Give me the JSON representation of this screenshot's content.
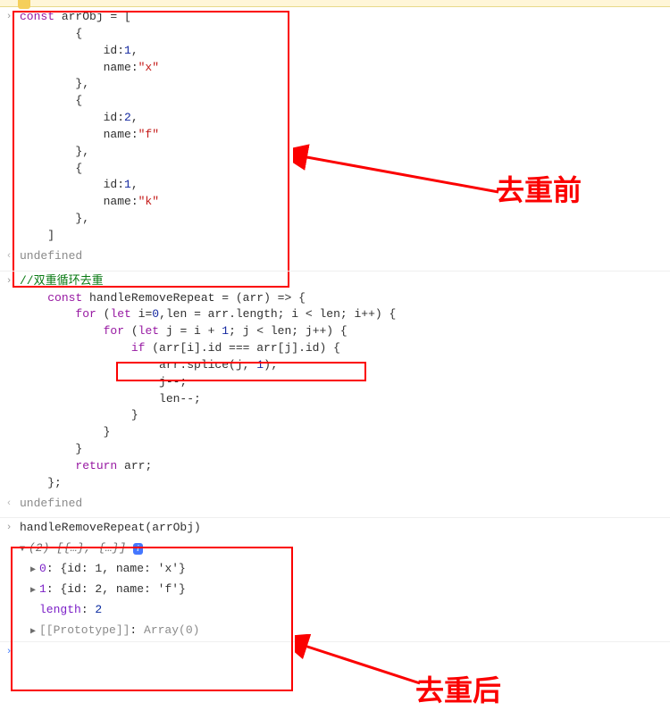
{
  "topWarning": "",
  "block1": {
    "lines": [
      "const arrObj = [",
      "        {",
      "            id:1,",
      "            name:\"x\"",
      "        },",
      "        {",
      "            id:2,",
      "            name:\"f\"",
      "        },",
      "        {",
      "            id:1,",
      "            name:\"k\"",
      "        },",
      "    ]"
    ],
    "result": "undefined"
  },
  "block2": {
    "comment": "//双重循环去重",
    "lines": [
      "    const handleRemoveRepeat = (arr) => {",
      "        for (let i=0,len = arr.length; i < len; i++) {",
      "            for (let j = i + 1; j < len; j++) {",
      "                if (arr[i].id === arr[j].id) {",
      "                    arr.splice(j, 1);",
      "                    j--;",
      "                    len--;",
      "                }",
      "            }",
      "        }",
      "        return arr;",
      "    };"
    ],
    "result": "undefined"
  },
  "block3": {
    "call": "handleRemoveRepeat(arrObj)",
    "summary": "(2) [{…}, {…}]",
    "item0_key": "0",
    "item0_val": "{id: 1, name: 'x'}",
    "item1_key": "1",
    "item1_val": "{id: 2, name: 'f'}",
    "length_key": "length",
    "length_val": "2",
    "proto_key": "[[Prototype]]",
    "proto_val": "Array(0)"
  },
  "annot": {
    "before": "去重前",
    "after": "去重后"
  },
  "infoBadge": "i"
}
